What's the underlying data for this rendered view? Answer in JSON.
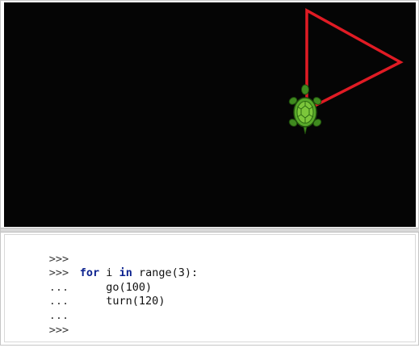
{
  "turtle": {
    "pen_color": "#e01b24",
    "canvas_background": "#050505",
    "shell_color": "#58a82a",
    "icon": "turtle-icon"
  },
  "console": {
    "lines": [
      {
        "prompt": ">>>",
        "keyword": "",
        "code": ""
      },
      {
        "prompt": ">>>",
        "keyword": "for",
        "code": " i ",
        "keyword2": "in",
        "code2": " range(3):"
      },
      {
        "prompt": "...",
        "keyword": "",
        "code": "    go(100)"
      },
      {
        "prompt": "...",
        "keyword": "",
        "code": "    turn(120)"
      },
      {
        "prompt": "...",
        "keyword": "",
        "code": ""
      },
      {
        "prompt": ">>>",
        "keyword": "",
        "code": ""
      }
    ]
  }
}
